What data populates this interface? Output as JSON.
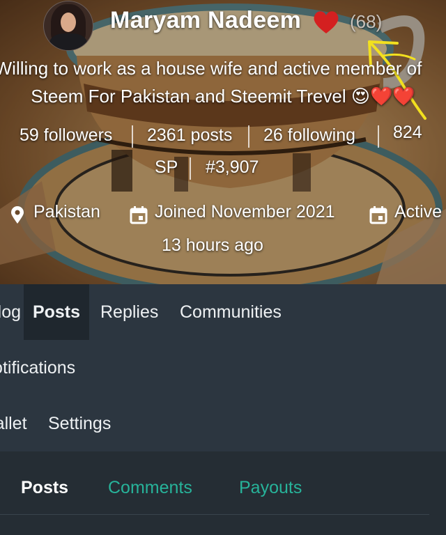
{
  "profile": {
    "name": "Maryam Nadeem",
    "reputation": "(68)",
    "about_line1": "Willing to work as a house wife and active member of",
    "about_line2": "Steem For Pakistan and Steemit Trevel",
    "about_emoji": "😍❤️❤️",
    "stats": {
      "followers": "59 followers",
      "posts": "2361 posts",
      "following": "26 following",
      "sp_value": "824",
      "sp_label": "SP",
      "rank": "#3,907"
    },
    "location": "Pakistan",
    "joined": "Joined November 2021",
    "active_label": "Active",
    "active_time": "13 hours ago"
  },
  "nav": {
    "tabs": [
      "Blog",
      "Posts",
      "Replies",
      "Communities"
    ],
    "active": "Posts",
    "notifications": "Notifications",
    "wallet": "Wallet",
    "settings": "Settings"
  },
  "subnav": {
    "tabs": [
      "Posts",
      "Comments",
      "Payouts"
    ],
    "active": "Posts"
  },
  "colors": {
    "nav_bg": "#2c3640",
    "active_tab_bg": "#1f272e",
    "link_green": "#27b39a",
    "heart_red": "#d42020",
    "annotation_yellow": "#f2e01f"
  }
}
